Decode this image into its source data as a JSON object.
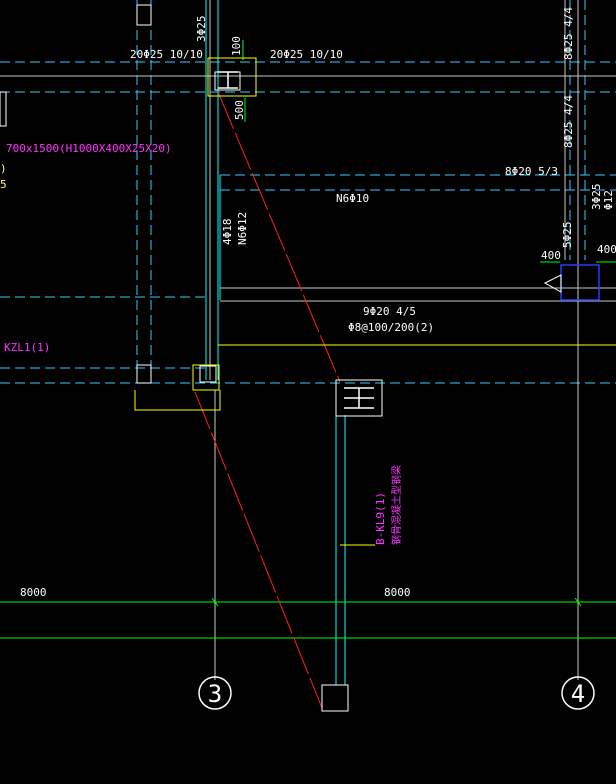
{
  "labels": {
    "top_rebar_left": "20Φ25 10/10",
    "top_rebar_right": "20Φ25 10/10",
    "col_top_rebar": "3Φ25",
    "dim_100": "100",
    "dim_500": "500",
    "beam_section": "700x1500(H1000X400X25X20)",
    "left_paren": ")",
    "left_five": "5",
    "right_top_rebar_1": "8Φ25 4/4",
    "right_top_rebar_2": "8Φ25 4/4",
    "rebar_8phi20": "8Φ20 5/3",
    "n6_label": "N6Φ10",
    "four_phi18": "4Φ18",
    "n6_vertical": "N6Φ12",
    "right_col_1": "3Φ25",
    "right_col_2": "Φ12",
    "dim_400_a": "400",
    "dim_400_b": "400",
    "rebar_5phi25": "5Φ25",
    "beam_9phi20": "9Φ20 4/5",
    "stirrup": "Φ8@100/200(2)",
    "kzl1": "KZL1(1)",
    "kl9": "B-KL9(1)",
    "kl9_note": "钢骨混凝土型钢梁",
    "dim_8000_left": "8000",
    "dim_8000_right": "8000",
    "axis_3": "3",
    "axis_4": "4"
  },
  "colors": {
    "background": "#000000",
    "axis_cyan": "#00ffff",
    "beam_dashed": "#33ccff",
    "grid_white": "#c8c8c8",
    "dim_green": "#00ff00",
    "section_red": "#ff2020",
    "yellow": "#ffff00",
    "magenta": "#ff33ff",
    "blue": "#2040ff"
  }
}
